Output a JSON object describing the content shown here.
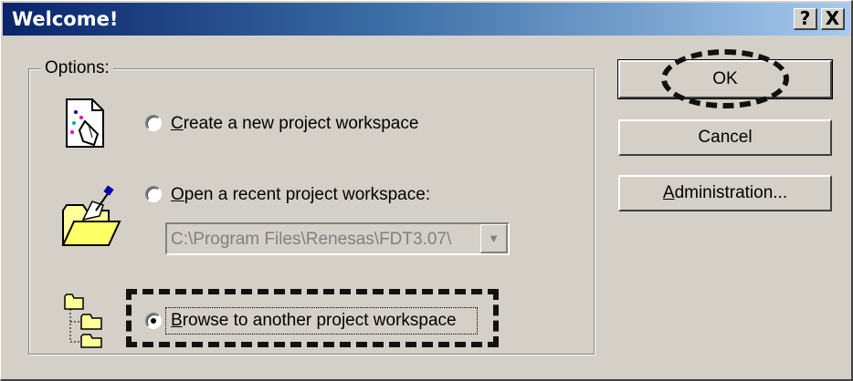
{
  "dialog": {
    "title": "Welcome!",
    "help_button": "?",
    "close_button": "X"
  },
  "options": {
    "group_label": "Options:",
    "create": {
      "label": "Create a new project workspace",
      "mnemonic": "C",
      "rest": "reate a new project workspace",
      "selected": false
    },
    "open_recent": {
      "label": "Open a recent project workspace:",
      "mnemonic": "O",
      "rest": "pen a recent project workspace:",
      "selected": false
    },
    "recent_combo_value": "C:\\Program Files\\Renesas\\FDT3.07\\",
    "browse": {
      "label": "Browse to another project workspace",
      "mnemonic": "B",
      "rest": "rowse to another project workspace",
      "selected": true
    }
  },
  "buttons": {
    "ok": "OK",
    "cancel": "Cancel",
    "administration": "Administration...",
    "administration_mnemonic": "A",
    "administration_rest": "dministration..."
  },
  "icons": [
    "new-project-icon",
    "open-folder-icon",
    "folder-tree-icon",
    "dropdown-arrow-icon"
  ],
  "colors": {
    "title_bar_start": "#0a246a",
    "title_bar_end": "#a6caf0",
    "dialog_face": "#d4d0c8"
  }
}
